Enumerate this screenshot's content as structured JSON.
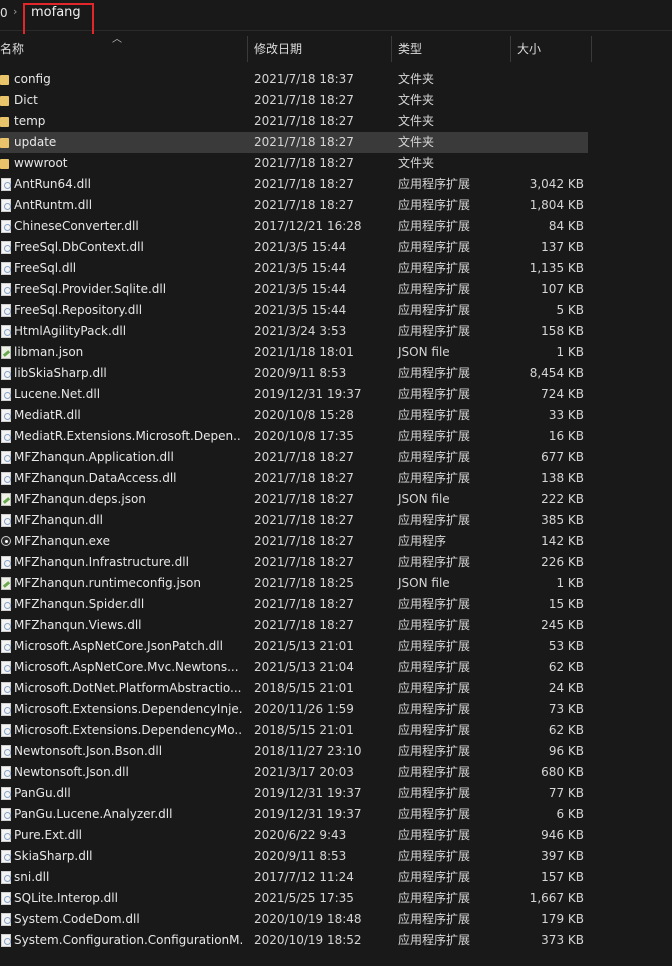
{
  "address": {
    "root": "0",
    "separator": "›",
    "current": "mofang"
  },
  "columns": {
    "name": "名称",
    "date": "修改日期",
    "type": "类型",
    "size": "大小"
  },
  "files": [
    {
      "name": "config",
      "date": "2021/7/18 18:37",
      "type": "文件夹",
      "size": "",
      "icon": "folder-icon",
      "kind": "folder"
    },
    {
      "name": "Dict",
      "date": "2021/7/18 18:27",
      "type": "文件夹",
      "size": "",
      "icon": "folder-icon",
      "kind": "folder"
    },
    {
      "name": "temp",
      "date": "2021/7/18 18:27",
      "type": "文件夹",
      "size": "",
      "icon": "folder-icon",
      "kind": "folder"
    },
    {
      "name": "update",
      "date": "2021/7/18 18:27",
      "type": "文件夹",
      "size": "",
      "icon": "folder-icon",
      "kind": "folder",
      "selected": true
    },
    {
      "name": "wwwroot",
      "date": "2021/7/18 18:27",
      "type": "文件夹",
      "size": "",
      "icon": "folder-icon",
      "kind": "folder"
    },
    {
      "name": "AntRun64.dll",
      "date": "2021/7/18 18:27",
      "type": "应用程序扩展",
      "size": "3,042 KB",
      "icon": "dll-icon",
      "kind": "dll"
    },
    {
      "name": "AntRuntm.dll",
      "date": "2021/7/18 18:27",
      "type": "应用程序扩展",
      "size": "1,804 KB",
      "icon": "dll-icon",
      "kind": "dll"
    },
    {
      "name": "ChineseConverter.dll",
      "date": "2017/12/21 16:28",
      "type": "应用程序扩展",
      "size": "84 KB",
      "icon": "dll-icon",
      "kind": "dll"
    },
    {
      "name": "FreeSql.DbContext.dll",
      "date": "2021/3/5 15:44",
      "type": "应用程序扩展",
      "size": "137 KB",
      "icon": "dll-icon",
      "kind": "dll"
    },
    {
      "name": "FreeSql.dll",
      "date": "2021/3/5 15:44",
      "type": "应用程序扩展",
      "size": "1,135 KB",
      "icon": "dll-icon",
      "kind": "dll"
    },
    {
      "name": "FreeSql.Provider.Sqlite.dll",
      "date": "2021/3/5 15:44",
      "type": "应用程序扩展",
      "size": "107 KB",
      "icon": "dll-icon",
      "kind": "dll"
    },
    {
      "name": "FreeSql.Repository.dll",
      "date": "2021/3/5 15:44",
      "type": "应用程序扩展",
      "size": "5 KB",
      "icon": "dll-icon",
      "kind": "dll"
    },
    {
      "name": "HtmlAgilityPack.dll",
      "date": "2021/3/24 3:53",
      "type": "应用程序扩展",
      "size": "158 KB",
      "icon": "dll-icon",
      "kind": "dll"
    },
    {
      "name": "libman.json",
      "date": "2021/1/18 18:01",
      "type": "JSON file",
      "size": "1 KB",
      "icon": "json-file-icon",
      "kind": "json"
    },
    {
      "name": "libSkiaSharp.dll",
      "date": "2020/9/11 8:53",
      "type": "应用程序扩展",
      "size": "8,454 KB",
      "icon": "dll-icon",
      "kind": "dll"
    },
    {
      "name": "Lucene.Net.dll",
      "date": "2019/12/31 19:37",
      "type": "应用程序扩展",
      "size": "724 KB",
      "icon": "dll-icon",
      "kind": "dll"
    },
    {
      "name": "MediatR.dll",
      "date": "2020/10/8 15:28",
      "type": "应用程序扩展",
      "size": "33 KB",
      "icon": "dll-icon",
      "kind": "dll"
    },
    {
      "name": "MediatR.Extensions.Microsoft.Depen...",
      "date": "2020/10/8 17:35",
      "type": "应用程序扩展",
      "size": "16 KB",
      "icon": "dll-icon",
      "kind": "dll"
    },
    {
      "name": "MFZhanqun.Application.dll",
      "date": "2021/7/18 18:27",
      "type": "应用程序扩展",
      "size": "677 KB",
      "icon": "dll-icon",
      "kind": "dll"
    },
    {
      "name": "MFZhanqun.DataAccess.dll",
      "date": "2021/7/18 18:27",
      "type": "应用程序扩展",
      "size": "138 KB",
      "icon": "dll-icon",
      "kind": "dll"
    },
    {
      "name": "MFZhanqun.deps.json",
      "date": "2021/7/18 18:27",
      "type": "JSON file",
      "size": "222 KB",
      "icon": "json-file-icon",
      "kind": "json"
    },
    {
      "name": "MFZhanqun.dll",
      "date": "2021/7/18 18:27",
      "type": "应用程序扩展",
      "size": "385 KB",
      "icon": "dll-icon",
      "kind": "dll"
    },
    {
      "name": "MFZhanqun.exe",
      "date": "2021/7/18 18:27",
      "type": "应用程序",
      "size": "142 KB",
      "icon": "exe-icon",
      "kind": "exe"
    },
    {
      "name": "MFZhanqun.Infrastructure.dll",
      "date": "2021/7/18 18:27",
      "type": "应用程序扩展",
      "size": "226 KB",
      "icon": "dll-icon",
      "kind": "dll"
    },
    {
      "name": "MFZhanqun.runtimeconfig.json",
      "date": "2021/7/18 18:25",
      "type": "JSON file",
      "size": "1 KB",
      "icon": "json-file-icon",
      "kind": "json"
    },
    {
      "name": "MFZhanqun.Spider.dll",
      "date": "2021/7/18 18:27",
      "type": "应用程序扩展",
      "size": "15 KB",
      "icon": "dll-icon",
      "kind": "dll"
    },
    {
      "name": "MFZhanqun.Views.dll",
      "date": "2021/7/18 18:27",
      "type": "应用程序扩展",
      "size": "245 KB",
      "icon": "dll-icon",
      "kind": "dll"
    },
    {
      "name": "Microsoft.AspNetCore.JsonPatch.dll",
      "date": "2021/5/13 21:01",
      "type": "应用程序扩展",
      "size": "53 KB",
      "icon": "dll-icon",
      "kind": "dll"
    },
    {
      "name": "Microsoft.AspNetCore.Mvc.Newtons...",
      "date": "2021/5/13 21:04",
      "type": "应用程序扩展",
      "size": "62 KB",
      "icon": "dll-icon",
      "kind": "dll"
    },
    {
      "name": "Microsoft.DotNet.PlatformAbstractio...",
      "date": "2018/5/15 21:01",
      "type": "应用程序扩展",
      "size": "24 KB",
      "icon": "dll-icon",
      "kind": "dll"
    },
    {
      "name": "Microsoft.Extensions.DependencyInje...",
      "date": "2020/11/26 1:59",
      "type": "应用程序扩展",
      "size": "73 KB",
      "icon": "dll-icon",
      "kind": "dll"
    },
    {
      "name": "Microsoft.Extensions.DependencyMo...",
      "date": "2018/5/15 21:01",
      "type": "应用程序扩展",
      "size": "62 KB",
      "icon": "dll-icon",
      "kind": "dll"
    },
    {
      "name": "Newtonsoft.Json.Bson.dll",
      "date": "2018/11/27 23:10",
      "type": "应用程序扩展",
      "size": "96 KB",
      "icon": "dll-icon",
      "kind": "dll"
    },
    {
      "name": "Newtonsoft.Json.dll",
      "date": "2021/3/17 20:03",
      "type": "应用程序扩展",
      "size": "680 KB",
      "icon": "dll-icon",
      "kind": "dll"
    },
    {
      "name": "PanGu.dll",
      "date": "2019/12/31 19:37",
      "type": "应用程序扩展",
      "size": "77 KB",
      "icon": "dll-icon",
      "kind": "dll"
    },
    {
      "name": "PanGu.Lucene.Analyzer.dll",
      "date": "2019/12/31 19:37",
      "type": "应用程序扩展",
      "size": "6 KB",
      "icon": "dll-icon",
      "kind": "dll"
    },
    {
      "name": "Pure.Ext.dll",
      "date": "2020/6/22 9:43",
      "type": "应用程序扩展",
      "size": "946 KB",
      "icon": "dll-icon",
      "kind": "dll"
    },
    {
      "name": "SkiaSharp.dll",
      "date": "2020/9/11 8:53",
      "type": "应用程序扩展",
      "size": "397 KB",
      "icon": "dll-icon",
      "kind": "dll"
    },
    {
      "name": "sni.dll",
      "date": "2017/7/12 11:24",
      "type": "应用程序扩展",
      "size": "157 KB",
      "icon": "dll-icon",
      "kind": "dll"
    },
    {
      "name": "SQLite.Interop.dll",
      "date": "2021/5/25 17:35",
      "type": "应用程序扩展",
      "size": "1,667 KB",
      "icon": "dll-icon",
      "kind": "dll"
    },
    {
      "name": "System.CodeDom.dll",
      "date": "2020/10/19 18:48",
      "type": "应用程序扩展",
      "size": "179 KB",
      "icon": "dll-icon",
      "kind": "dll"
    },
    {
      "name": "System.Configuration.ConfigurationM...",
      "date": "2020/10/19 18:52",
      "type": "应用程序扩展",
      "size": "373 KB",
      "icon": "dll-icon",
      "kind": "dll"
    }
  ]
}
